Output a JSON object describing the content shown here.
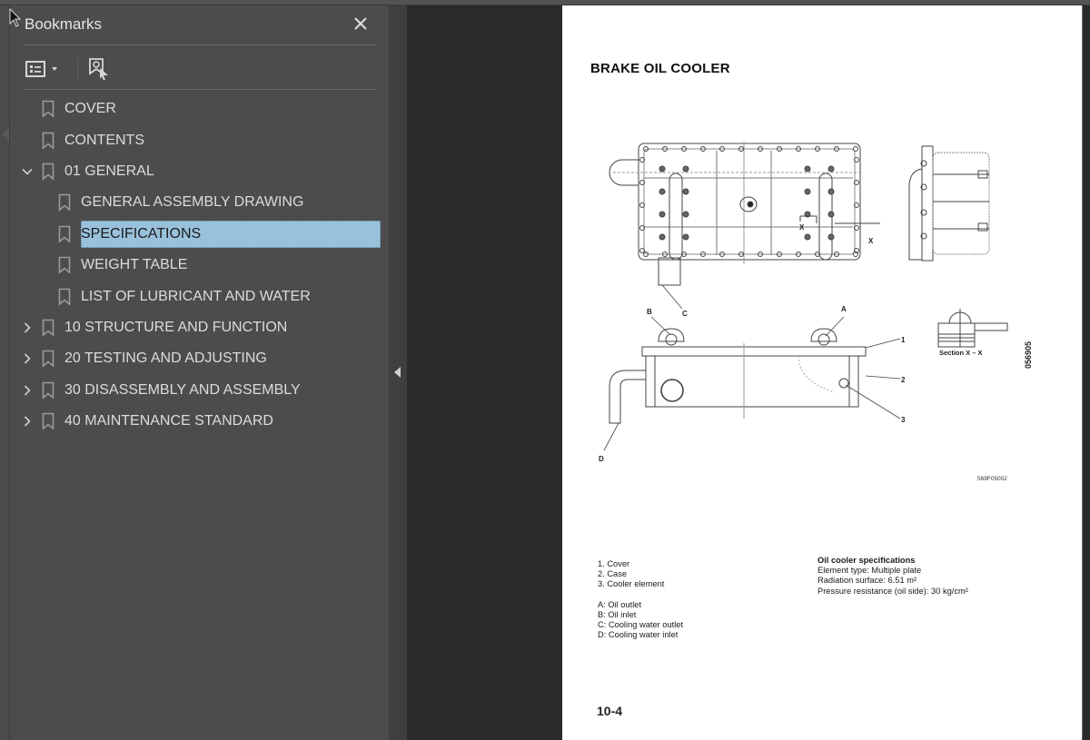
{
  "panel": {
    "title": "Bookmarks",
    "close_icon": "close-icon",
    "toolbar": {
      "options_icon": "list-options-icon",
      "options_dropdown_icon": "caret-down-icon",
      "find_bookmark_icon": "find-current-bookmark-icon"
    }
  },
  "bookmarks": [
    {
      "label": "COVER",
      "level": 0,
      "expander": "none",
      "selected": false
    },
    {
      "label": "CONTENTS",
      "level": 0,
      "expander": "none",
      "selected": false
    },
    {
      "label": "01 GENERAL",
      "level": 0,
      "expander": "expanded",
      "selected": false
    },
    {
      "label": "GENERAL ASSEMBLY DRAWING",
      "level": 1,
      "expander": "none",
      "selected": false
    },
    {
      "label": "SPECIFICATIONS",
      "level": 1,
      "expander": "none",
      "selected": true
    },
    {
      "label": "WEIGHT TABLE",
      "level": 1,
      "expander": "none",
      "selected": false
    },
    {
      "label": "LIST OF LUBRICANT AND WATER",
      "level": 1,
      "expander": "none",
      "selected": false
    },
    {
      "label": "10 STRUCTURE AND FUNCTION",
      "level": 0,
      "expander": "collapsed",
      "selected": false
    },
    {
      "label": "20 TESTING AND ADJUSTING",
      "level": 0,
      "expander": "collapsed",
      "selected": false
    },
    {
      "label": "30 DISASSEMBLY AND ASSEMBLY",
      "level": 0,
      "expander": "collapsed",
      "selected": false
    },
    {
      "label": "40 MAINTENANCE STANDARD",
      "level": 0,
      "expander": "collapsed",
      "selected": false
    }
  ],
  "colors": {
    "selection": "#99c1dc",
    "panel_bg": "#4c4c4c",
    "viewer_bg": "#2a2a2a"
  },
  "document": {
    "title": "BRAKE OIL COOLER",
    "drawing_labels": {
      "A": "A",
      "B": "B",
      "C": "C",
      "D": "D",
      "n1": "1",
      "n2": "2",
      "n3": "3",
      "x1": "X",
      "x2": "X"
    },
    "section_label": "Section X – X",
    "drawing_code": "569F05002",
    "vertical_code": "056905",
    "legend_numbers": [
      "1. Cover",
      "2. Case",
      "3. Cooler element"
    ],
    "legend_letters": [
      "A: Oil outlet",
      "B: Oil inlet",
      "C: Cooling water outlet",
      "D: Cooling water inlet"
    ],
    "specs": {
      "title": "Oil cooler specifications",
      "lines": [
        "Element type: Multiple plate",
        "Radiation surface: 6.51 m²",
        "Pressure resistance (oil side): 30 kg/cm²"
      ]
    },
    "page_number": "10-4"
  }
}
